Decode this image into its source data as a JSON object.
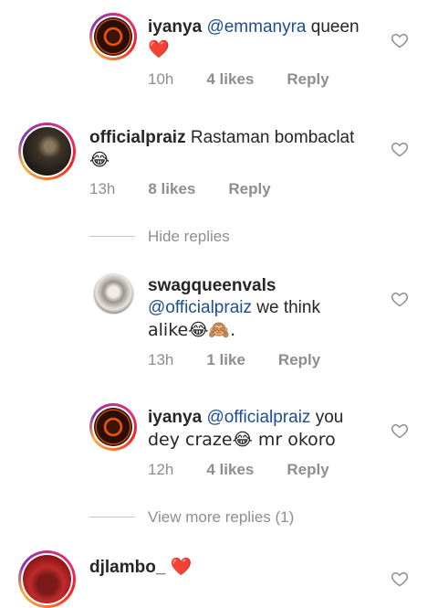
{
  "comments": [
    {
      "username": "iyanya",
      "mention": "@emmanyra",
      "text_after": " queen",
      "emoji": "❤️",
      "time": "10h",
      "likes": "4 likes",
      "reply": "Reply"
    },
    {
      "username": "officialpraiz",
      "text": "Rastaman bombaclat",
      "emoji": "😂",
      "time": "13h",
      "likes": "8 likes",
      "reply": "Reply"
    },
    {
      "username": "swagqueenvals",
      "mention": "@officialpraiz",
      "text_after": "  we think",
      "line2": "alike😂🙈.",
      "time": "13h",
      "likes": "1 like",
      "reply": "Reply"
    },
    {
      "username": "iyanya",
      "mention": "@officialpraiz",
      "text_after": " you",
      "line2": "dey craze😂 mr okoro",
      "time": "12h",
      "likes": "4 likes",
      "reply": "Reply"
    },
    {
      "username": "djlambo_",
      "emoji": "❤️"
    }
  ],
  "hide_replies": "Hide replies",
  "view_more": "View more replies (1)"
}
